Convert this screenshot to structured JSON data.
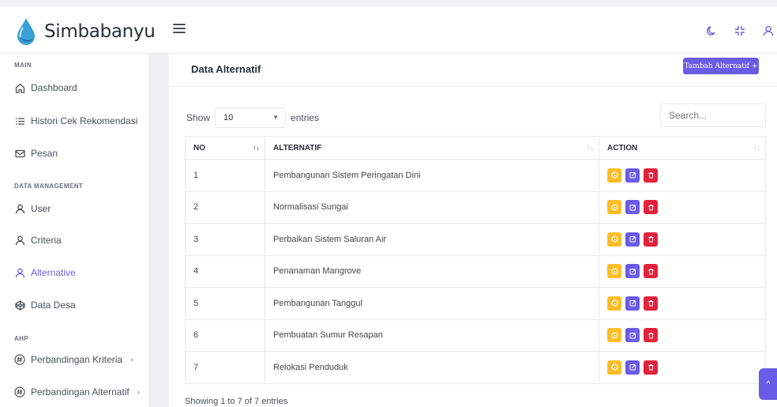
{
  "app": {
    "name": "Simbabanyu"
  },
  "sidebar": {
    "sections": [
      {
        "label": "MAIN"
      },
      {
        "label": "DATA MANAGEMENT"
      },
      {
        "label": "AHP"
      }
    ],
    "items": [
      {
        "label": "Dashboard",
        "icon": "home-icon"
      },
      {
        "label": "Histori Cek Rekomendasi",
        "icon": "list-icon"
      },
      {
        "label": "Pesan",
        "icon": "mail-icon"
      },
      {
        "label": "User",
        "icon": "user-icon"
      },
      {
        "label": "Criteria",
        "icon": "user-icon"
      },
      {
        "label": "Alternative",
        "icon": "user-icon",
        "active": true
      },
      {
        "label": "Data Desa",
        "icon": "codepen-icon"
      },
      {
        "label": "Perbandingan Kriteria",
        "icon": "hash-circle-icon"
      },
      {
        "label": "Perbandingan Alternatif",
        "icon": "hash-circle-icon"
      }
    ]
  },
  "header": {
    "icons": [
      "menu-icon",
      "moon-icon",
      "minimize-icon",
      "user-icon"
    ]
  },
  "card": {
    "title": "Data Alternatif",
    "add_button": "Tambah Alternatif +",
    "length": {
      "show": "Show",
      "value": "10",
      "entries": "entries"
    },
    "search_placeholder": "Search...",
    "columns": [
      "NO",
      "ALTERNATIF",
      "ACTION"
    ],
    "rows": [
      {
        "no": "1",
        "alternatif": "Pembangunan Sistem Peringatan Dini"
      },
      {
        "no": "2",
        "alternatif": "Normalisasi Sungai"
      },
      {
        "no": "3",
        "alternatif": "Perbaikan Sistem Saluran Air"
      },
      {
        "no": "4",
        "alternatif": "Penanaman Mangrove"
      },
      {
        "no": "5",
        "alternatif": "Pembangunan Tanggul"
      },
      {
        "no": "6",
        "alternatif": "Pembuatan Sumur Resapan"
      },
      {
        "no": "7",
        "alternatif": "Relokasi Penduduk"
      }
    ],
    "footer": "Showing 1 to 7 of 7 entries"
  },
  "colors": {
    "accent": "#6b5ce7",
    "warning": "#fcbd26",
    "danger": "#e3213b"
  }
}
